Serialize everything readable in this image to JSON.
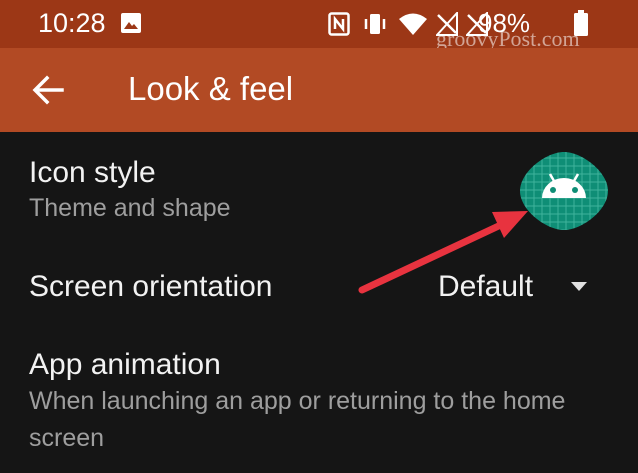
{
  "status_bar": {
    "time": "10:28",
    "battery_percent": "98%",
    "icons": [
      "image-icon",
      "nfc-icon",
      "vibrate-icon",
      "wifi-icon",
      "signal-off-icon",
      "signal-off-icon",
      "battery-icon"
    ]
  },
  "watermark": "groovyPost.com",
  "app_bar": {
    "title": "Look & feel",
    "back_icon": "arrow-left-icon"
  },
  "settings": {
    "icon_style": {
      "title": "Icon style",
      "subtitle": "Theme and shape",
      "preview_icon": "android-robot-icon"
    },
    "screen_orientation": {
      "title": "Screen orientation",
      "value": "Default",
      "dropdown_icon": "triangle-down-icon"
    },
    "app_animation": {
      "title": "App animation",
      "subtitle": "When launching an app or returning to the home screen"
    }
  },
  "colors": {
    "status_bar": "#9c3716",
    "app_bar": "#b24a24",
    "background": "#151515",
    "icon_teal": "#0f8e76",
    "annotation_arrow": "#e8333f"
  }
}
